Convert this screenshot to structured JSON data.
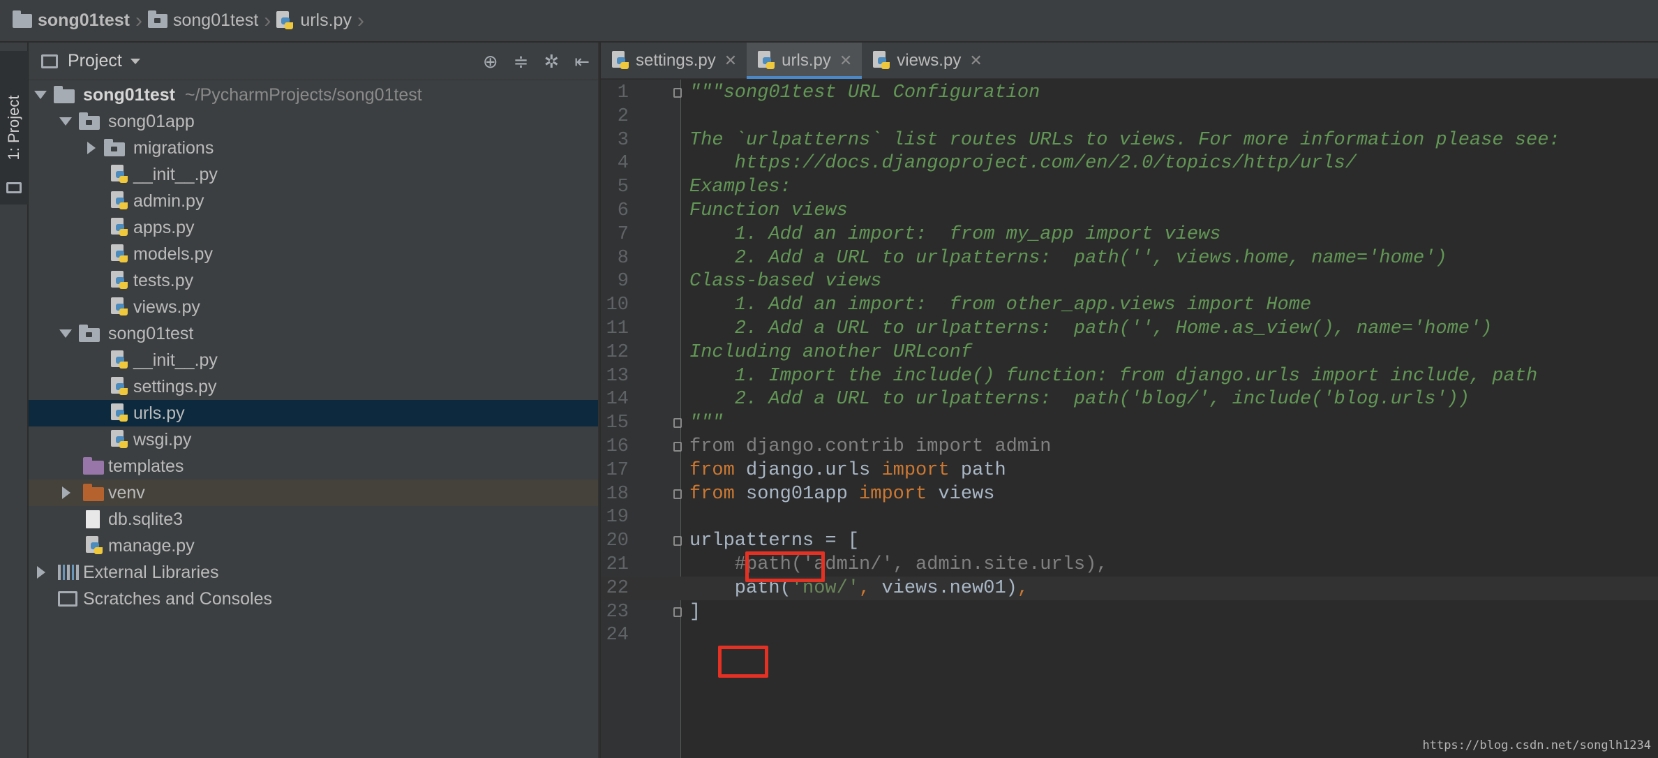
{
  "breadcrumb": {
    "items": [
      "song01test",
      "song01test",
      "urls.py"
    ]
  },
  "toolstrip": {
    "tab_label": "1: Project"
  },
  "project_panel": {
    "title": "Project",
    "tools": [
      "target-icon",
      "collapse-icon",
      "gear-icon",
      "hide-icon"
    ],
    "tree": [
      {
        "label": "song01test",
        "hint": "~/PycharmProjects/song01test",
        "type": "folder"
      },
      {
        "label": "song01app",
        "type": "module-folder"
      },
      {
        "label": "migrations",
        "type": "module-folder"
      },
      {
        "label": "__init__.py",
        "type": "python"
      },
      {
        "label": "admin.py",
        "type": "python"
      },
      {
        "label": "apps.py",
        "type": "python"
      },
      {
        "label": "models.py",
        "type": "python"
      },
      {
        "label": "tests.py",
        "type": "python"
      },
      {
        "label": "views.py",
        "type": "python"
      },
      {
        "label": "song01test",
        "type": "module-folder"
      },
      {
        "label": "__init__.py",
        "type": "python"
      },
      {
        "label": "settings.py",
        "type": "python"
      },
      {
        "label": "urls.py",
        "type": "python"
      },
      {
        "label": "wsgi.py",
        "type": "python"
      },
      {
        "label": "templates",
        "type": "templates-folder"
      },
      {
        "label": "venv",
        "type": "excluded-folder"
      },
      {
        "label": "db.sqlite3",
        "type": "file"
      },
      {
        "label": "manage.py",
        "type": "python"
      },
      {
        "label": "External Libraries",
        "type": "libraries"
      },
      {
        "label": "Scratches and Consoles",
        "type": "scratches"
      }
    ]
  },
  "tabs": [
    {
      "label": "settings.py",
      "active": false
    },
    {
      "label": "urls.py",
      "active": true
    },
    {
      "label": "views.py",
      "active": false
    }
  ],
  "editor": {
    "lines": [
      "\"\"\"song01test URL Configuration",
      "",
      "The `urlpatterns` list routes URLs to views. For more information please see:",
      "    https://docs.djangoproject.com/en/2.0/topics/http/urls/",
      "Examples:",
      "Function views",
      "    1. Add an import:  from my_app import views",
      "    2. Add a URL to urlpatterns:  path('', views.home, name='home')",
      "Class-based views",
      "    1. Add an import:  from other_app.views import Home",
      "    2. Add a URL to urlpatterns:  path('', Home.as_view(), name='home')",
      "Including another URLconf",
      "    1. Import the include() function: from django.urls import include, path",
      "    2. Add a URL to urlpatterns:  path('blog/', include('blog.urls'))",
      "\"\"\"",
      "from django.contrib import admin",
      "from django.urls import path",
      "from song01app import views",
      "",
      "urlpatterns = [",
      "    #path('admin/', admin.site.urls),",
      "    path('now/', views.new01),",
      "]",
      ""
    ]
  },
  "watermark": "https://blog.csdn.net/songlh1234",
  "colors": {
    "keyword": "#cc7832",
    "docstring": "#629755",
    "string": "#6a8759",
    "identifier": "#a9b7c6",
    "highlight": "#e53024",
    "selection": "#0d293e"
  }
}
